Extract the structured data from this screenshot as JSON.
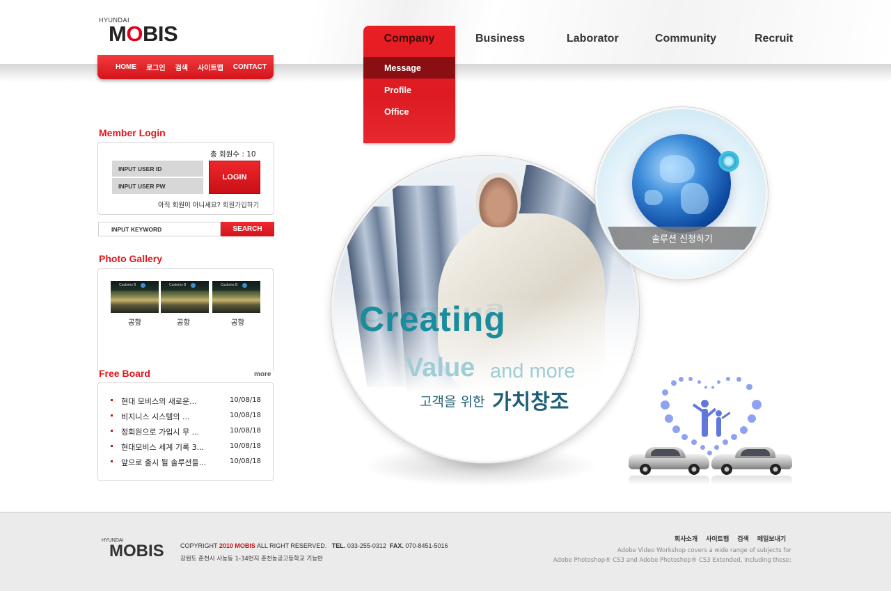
{
  "brand": {
    "small": "HYUNDAI",
    "big_prefix": "M",
    "big_o": "O",
    "big_suffix": "BIS"
  },
  "util_nav": [
    "HOME",
    "로그인",
    "검색",
    "사이트맵",
    "CONTACT"
  ],
  "main_nav": {
    "active": "Company",
    "items": [
      "Business",
      "Laborator",
      "Community",
      "Recruit"
    ],
    "submenu": [
      "Message",
      "Profile",
      "Office"
    ]
  },
  "member_login": {
    "title": "Member Login",
    "member_count": "총 회원수 : 10",
    "id_placeholder": "INPUT USER ID",
    "pw_placeholder": "INPUT USER PW",
    "login_button": "LOGIN",
    "not_member": "아직 회원이 아니세요?",
    "join_link": "회원가입하기"
  },
  "search": {
    "placeholder": "INPUT KEYWORD",
    "button": "SEARCH"
  },
  "photo_gallery": {
    "title": "Photo Gallery",
    "items": [
      {
        "caption": "공항",
        "sign": "Customs B"
      },
      {
        "caption": "공항",
        "sign": "Customs B"
      },
      {
        "caption": "공항",
        "sign": "Customs B"
      }
    ]
  },
  "free_board": {
    "title": "Free Board",
    "more": "more",
    "rows": [
      {
        "title": "현대 모비스의 새로운...",
        "date": "10/08/18"
      },
      {
        "title": "비지니스 시스템의 ...",
        "date": "10/08/18"
      },
      {
        "title": "정회원으로 가입시 무 ...",
        "date": "10/08/18"
      },
      {
        "title": "현대모비스 세계 기록 3...",
        "date": "10/08/18"
      },
      {
        "title": "앞으로 출시 될 솔루션들...",
        "date": "10/08/18"
      }
    ]
  },
  "hero": {
    "headline": "Creating",
    "value": "Value",
    "and_more": "and more",
    "kor_small": "고객을 위한",
    "kor_big": "가치창조"
  },
  "solution": {
    "label": "솔루션 신청하기"
  },
  "footer": {
    "brand_small": "HYUNDAI",
    "brand_big": "MOBIS",
    "copy_prefix": "COPYRIGHT",
    "copy_year_brand": "2010 MOBIS",
    "copy_suffix": "ALL RIGHT RESERVED.",
    "tel_label": "TEL.",
    "tel": "033-255-0312",
    "fax_label": "FAX.",
    "fax": "070-8451-5016",
    "address": "강원도 춘천시 사농동 1-34번지 춘천농공고등학교 기능반",
    "links": [
      "회사소개",
      "사이트맵",
      "검색",
      "메일보내기"
    ],
    "desc1": "Adobe Video Workshop covers a wide range of subjects for",
    "desc2": "Adobe Photoshop® CS3 and Adobe Photoshop® CS3 Extended, including these:"
  },
  "colors": {
    "brand_red": "#e0001b",
    "teal": "#1b8c9c",
    "navy_text": "#1d5f76"
  }
}
